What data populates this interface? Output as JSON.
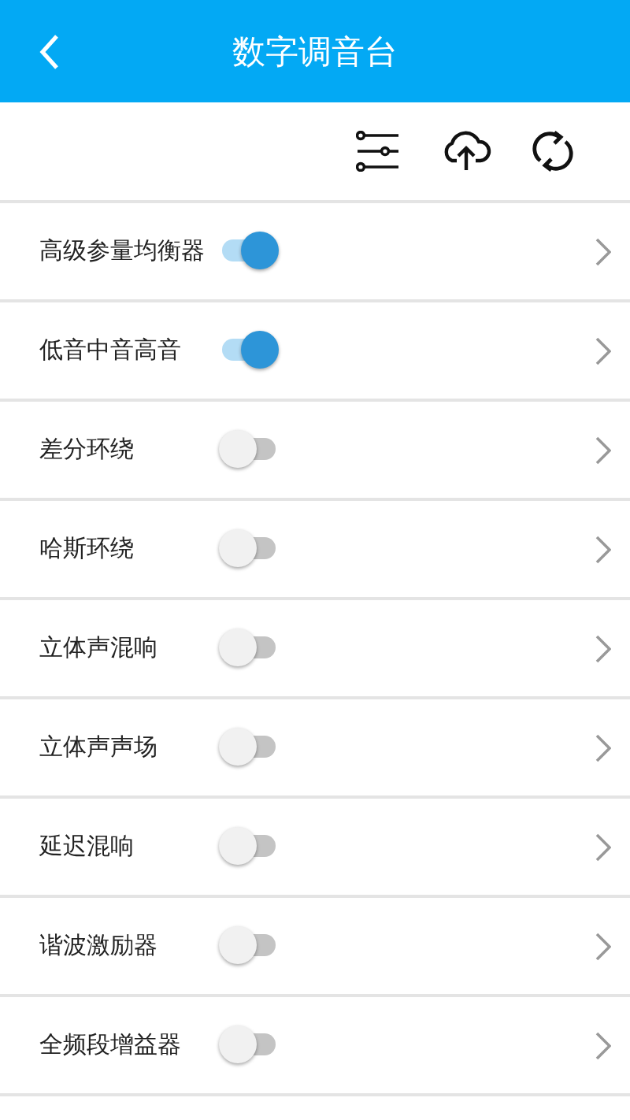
{
  "header": {
    "title": "数字调音台"
  },
  "rows": [
    {
      "label": "高级参量均衡器",
      "on": true
    },
    {
      "label": "低音中音高音",
      "on": true
    },
    {
      "label": "差分环绕",
      "on": false
    },
    {
      "label": "哈斯环绕",
      "on": false
    },
    {
      "label": "立体声混响",
      "on": false
    },
    {
      "label": "立体声声场",
      "on": false
    },
    {
      "label": "延迟混响",
      "on": false
    },
    {
      "label": "谐波激励器",
      "on": false
    },
    {
      "label": "全频段增益器",
      "on": false
    }
  ]
}
